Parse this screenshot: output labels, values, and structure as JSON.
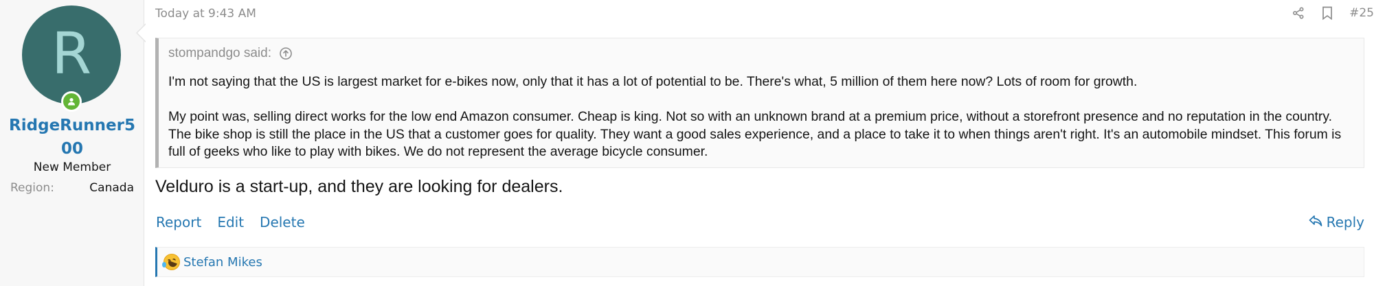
{
  "user": {
    "avatar_letter": "R",
    "avatar_bg": "#386d6c",
    "avatar_fg": "#a4d6d4",
    "status_icon": "user-online-icon",
    "username": "RidgeRunner500",
    "title": "New Member",
    "extra": {
      "label": "Region:",
      "value": "Canada"
    }
  },
  "post": {
    "date": "Today at 9:43 AM",
    "share_icon": "share-icon",
    "bookmark_icon": "bookmark-icon",
    "number": "#25",
    "quote": {
      "author_said": "stompandgo said:",
      "jump_icon": "arrow-up-circle-icon",
      "paragraphs": [
        "I'm not saying that the US is largest market for e-bikes now, only that it has a lot of potential to be. There's what, 5 million of them here now? Lots of room for growth.",
        "My point was, selling direct works for the low end Amazon consumer. Cheap is king. Not so with an unknown brand at a premium price, without a storefront presence and no reputation in the country. The bike shop is still the place in the US that a customer goes for quality. They want a good sales experience, and a place to take it to when things aren't right. It's an automobile mindset. This forum is full of geeks who like to play with bikes. We do not represent the average bicycle consumer."
      ]
    },
    "message": "Velduro is a start-up, and they are looking for dealers.",
    "footer": {
      "report": "Report",
      "edit": "Edit",
      "delete": "Delete",
      "reply": "Reply",
      "reply_icon": "reply-icon"
    },
    "reactions": {
      "emoji_icon": "rolling-laughing-emoji-icon",
      "users": "Stefan Mikes"
    }
  },
  "colors": {
    "link": "#2577b1",
    "muted": "#8c8c8c",
    "online": "#63b536"
  }
}
